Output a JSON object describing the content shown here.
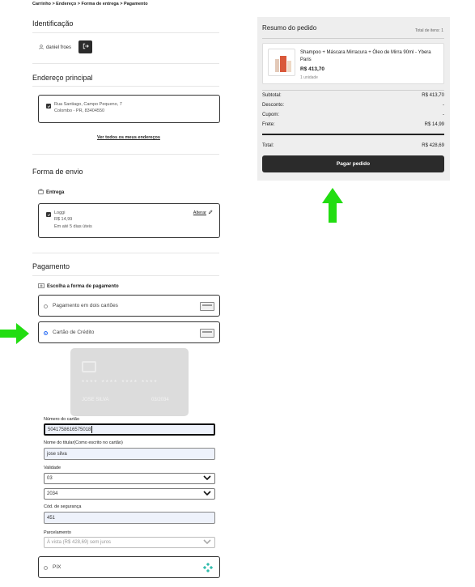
{
  "breadcrumb": "Carrinho > Endereço > Forma de entrega > Pagamento",
  "identification": {
    "title": "Identificação",
    "user_name": "daniel froes"
  },
  "address": {
    "title": "Endereço principal",
    "line1": "Rua Santiago, Campo Pequeno, 7",
    "line2": "Colombo - PR, 83404550",
    "see_all": "Ver todos os meus endereços"
  },
  "shipping": {
    "title": "Forma de envio",
    "subtitle": "Entrega",
    "carrier": "Loggi",
    "price": "R$ 14,99",
    "eta": "Em até 5 dias úteis",
    "change": "Alterar"
  },
  "payment": {
    "title": "Pagamento",
    "subtitle": "Escolha a forma de pagamento",
    "option_two_cards": "Pagamento em dois cartões",
    "option_credit": "Cartão de Crédito",
    "option_pix": "PIX",
    "card_preview": {
      "number_mask": "**** **** **** ****",
      "holder": "JOSE SILVA",
      "expiry": "03/2034"
    },
    "card_number_label": "Número do cartão",
    "card_number_value": "5041758616575018",
    "holder_label": "Nome do titular(Como escrito no cartão)",
    "holder_value": "jose silva",
    "validity_label": "Validade",
    "month_value": "03",
    "year_value": "2034",
    "cvv_label": "Cód. de segurança",
    "cvv_value": "451",
    "installments_label": "Parcelamento",
    "installments_value": "À vista (R$ 428,69) sem juros"
  },
  "summary": {
    "title": "Resumo do pedido",
    "total_items": "Total de itens: 1",
    "product_name": "Shampoo + Máscara Mirracura + Óleo de Mirra 90ml - Ybera Paris",
    "product_price": "R$ 413,70",
    "product_qty": "1 unidade",
    "subtotal_label": "Subtotal:",
    "subtotal_value": "R$ 413,70",
    "discount_label": "Desconto:",
    "discount_value": "-",
    "coupon_label": "Cupom:",
    "coupon_value": "-",
    "shipping_label": "Frete:",
    "shipping_value": "R$ 14,99",
    "total_label": "Total:",
    "total_value": "R$ 428,69",
    "pay_button": "Pagar pedido"
  },
  "colors": {
    "accent_arrow": "#22dd11",
    "dark": "#2b2b2b",
    "radio_blue": "#2a6df4",
    "summary_bg": "#eeeeee"
  }
}
